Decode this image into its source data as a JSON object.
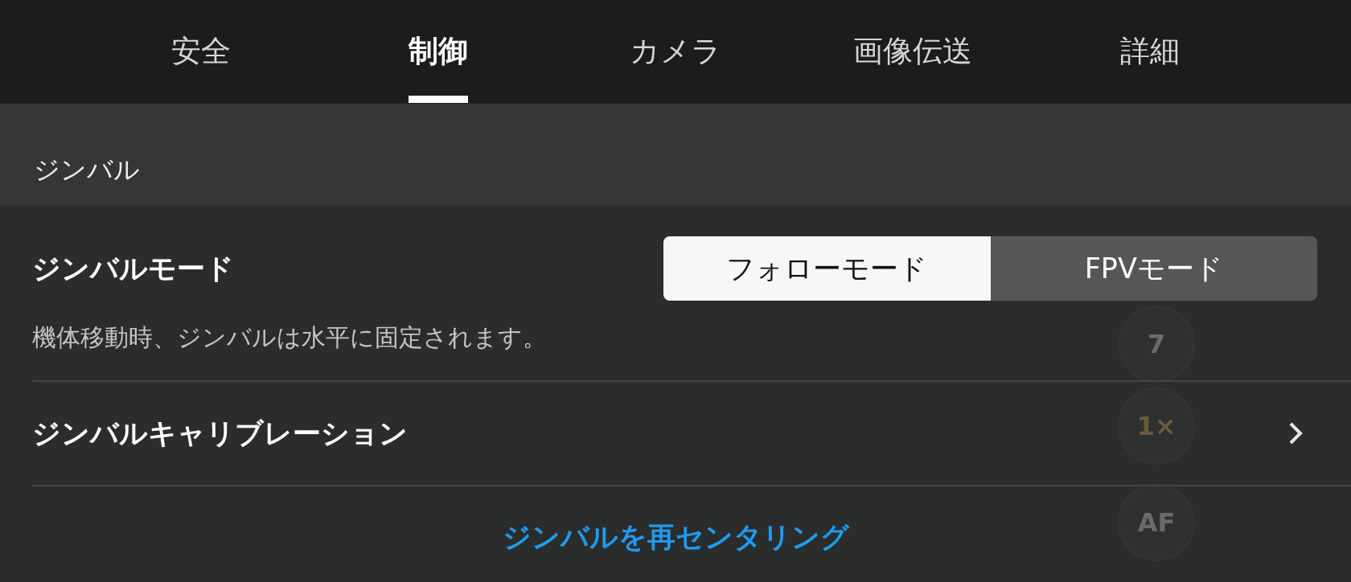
{
  "tabs": [
    {
      "label": "安全",
      "selected": false
    },
    {
      "label": "制御",
      "selected": true
    },
    {
      "label": "カメラ",
      "selected": false
    },
    {
      "label": "画像伝送",
      "selected": false
    },
    {
      "label": "詳細",
      "selected": false
    }
  ],
  "section": {
    "title": "ジンバル"
  },
  "gimbal_mode": {
    "label": "ジンバルモード",
    "options": [
      {
        "label": "フォローモード",
        "selected": true
      },
      {
        "label": "FPVモード",
        "selected": false
      }
    ],
    "description": "機体移動時、ジンバルは水平に固定されます。"
  },
  "calibration": {
    "label": "ジンバルキャリブレーション"
  },
  "recenter_link": "ジンバルを再センタリング",
  "background_controls": [
    "7",
    "1×",
    "AF"
  ]
}
